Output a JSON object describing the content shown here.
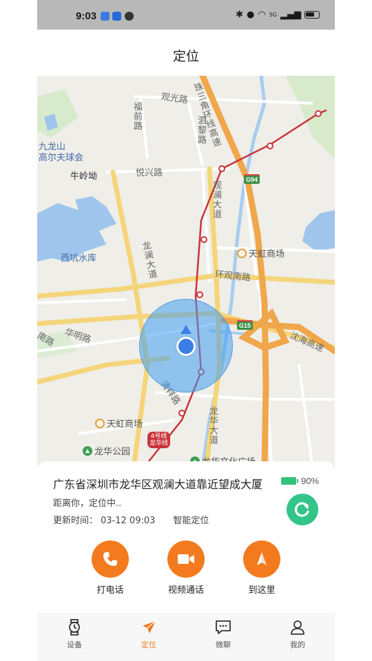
{
  "status_bar": {
    "time": "9:03",
    "network": "5G"
  },
  "header": {
    "title": "定位"
  },
  "map": {
    "roads": {
      "guanguang": "观光路",
      "zhusanjiao": "珠三角环线高速",
      "fuqian": "福前路",
      "sili": "泗黎路",
      "yuexing": "悦兴路",
      "guanlan": "观澜大道",
      "longlan": "龙澜大道",
      "huanguannan": "环观南路",
      "huaming": "华明路",
      "yanhai": "沈海高速",
      "qingxiang": "清祥路",
      "longhua": "龙华大道",
      "nan": "南路"
    },
    "places": {
      "golf": "九龙山\n高尔夫球会",
      "niuling": "牛岭坳",
      "xikeng": "西坑水库",
      "tianhong_north": "天虹商场",
      "tianhong_south": "天虹商场",
      "longhua_park": "龙华公园",
      "culture": "龙华文化广场"
    },
    "shields": {
      "g94": "G94",
      "g15": "G15"
    },
    "metro_badge": "4号线\n龙华线"
  },
  "info": {
    "address": "广东省深圳市龙华区观澜大道靠近望成大厦",
    "battery": "90%",
    "distance": "距离你，定位中..",
    "updated_label": "更新时间：",
    "updated_time": "03-12 09:03",
    "mode": "智能定位"
  },
  "actions": {
    "call": "打电话",
    "video": "视频通话",
    "navigate": "到这里"
  },
  "tabs": {
    "device": "设备",
    "location": "定位",
    "chat": "微聊",
    "mine": "我的"
  },
  "colors": {
    "accent": "#f47a1f",
    "refresh": "#33c48a",
    "battery": "#36c27a",
    "accuracy": "#409ef0"
  }
}
